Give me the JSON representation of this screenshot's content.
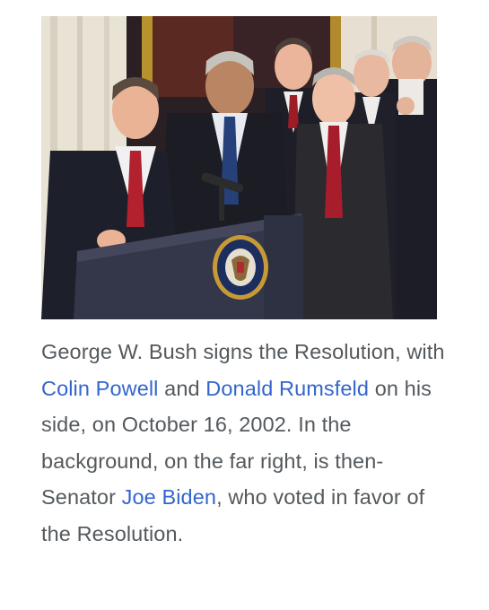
{
  "figure": {
    "image_alt": "George W. Bush at a podium with Colin Powell, Donald Rumsfeld and other officials standing behind him",
    "seal_text": "SEAL OF THE PRESIDENT OF THE UNITED STATES"
  },
  "caption": {
    "t1": "George W. Bush signs the Resolution, with ",
    "link_powell": "Colin Powell",
    "t2": " and ",
    "link_rumsfeld": "Donald Rumsfeld",
    "t3": " on his side, on October 16, 2002. In the background, on the far right, is then-Senator ",
    "link_biden": "Joe Biden",
    "t4": ", who voted in favor of the Resolution."
  },
  "colors": {
    "text": "#54595d",
    "link": "#3366cc"
  }
}
